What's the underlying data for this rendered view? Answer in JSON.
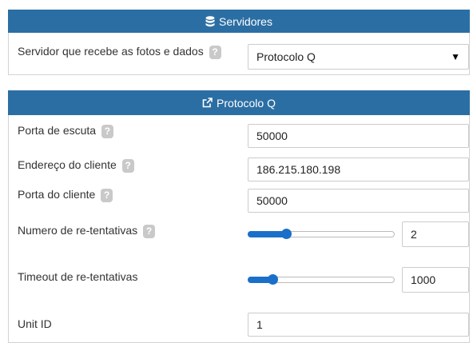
{
  "servidores": {
    "title": "Servidores",
    "icon": "database-icon",
    "server_label": "Servidor que recebe as fotos e dados",
    "server_value": "Protocolo Q",
    "help_glyph": "?"
  },
  "protocolo": {
    "title": "Protocolo Q",
    "icon": "external-link-icon",
    "porta_escuta_label": "Porta de escuta",
    "porta_escuta_value": "50000",
    "endereco_label": "Endereço do cliente",
    "endereco_value": "186.215.180.198",
    "porta_cliente_label": "Porta do cliente",
    "porta_cliente_value": "50000",
    "retentativas_label": "Numero de re-tentativas",
    "retentativas_value": "2",
    "retentativas_level": 0.26,
    "timeout_label": "Timeout de re-tentativas",
    "timeout_value": "1000",
    "timeout_level": 0.17,
    "unit_id_label": "Unit ID",
    "unit_id_value": "1"
  },
  "colors": {
    "header": "#2b6ea3",
    "accent": "#1a6fc9"
  }
}
